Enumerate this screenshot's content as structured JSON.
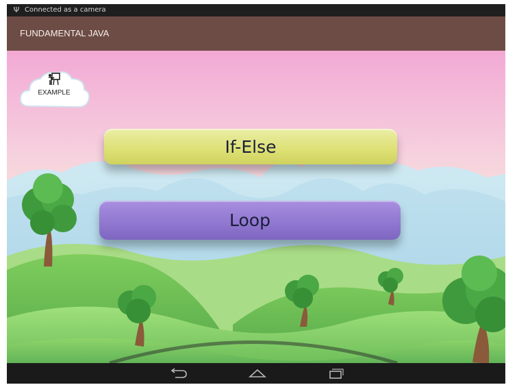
{
  "status_bar": {
    "usb_icon": "usb-icon",
    "text": "Connected as a camera"
  },
  "action_bar": {
    "title": "FUNDAMENTAL JAVA"
  },
  "example": {
    "label": "EXAMPLE",
    "icon": "teacher-board-icon"
  },
  "menu": {
    "if_else_label": "If-Else",
    "loop_label": "Loop"
  },
  "nav": {
    "back_icon": "back-icon",
    "home_icon": "home-icon",
    "recents_icon": "recent-apps-icon"
  },
  "colors": {
    "action_bar": "#6d4c45",
    "if_else_button": "#dde073",
    "loop_button": "#8f76cf",
    "sky_top": "#f2a9d5",
    "hills": "#6fbf5a"
  }
}
